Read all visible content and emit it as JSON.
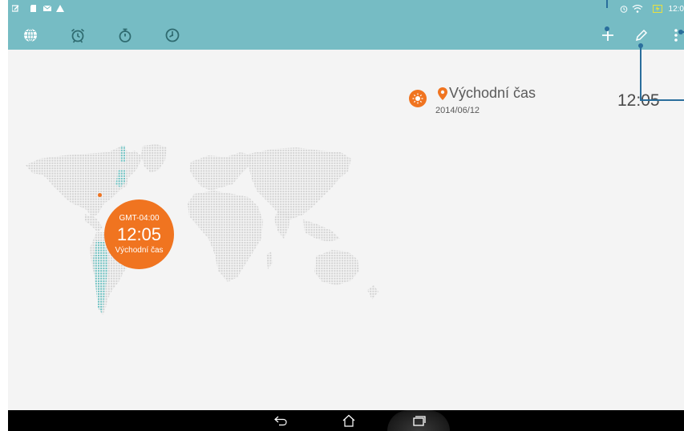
{
  "status_bar": {
    "time": "12:0",
    "left_icons": [
      "edit-notification-icon",
      "sd-card-icon",
      "mail-icon",
      "warning-icon"
    ],
    "right_icons": [
      "alarm-icon",
      "wifi-icon",
      "battery-charging-icon"
    ]
  },
  "action_bar": {
    "tabs": [
      "world-clock-tab",
      "alarm-tab",
      "stopwatch-tab",
      "timer-tab"
    ],
    "actions": [
      "add-icon",
      "edit-icon",
      "more-options-icon"
    ]
  },
  "city": {
    "name": "Východní čas",
    "date": "2014/06/12",
    "time": "12:05"
  },
  "map_bubble": {
    "timezone": "GMT-04:00",
    "time": "12:05",
    "city": "Východní čas"
  },
  "colors": {
    "header": "#76bcc4",
    "accent": "#f07420",
    "callout": "#2a6e9c"
  }
}
